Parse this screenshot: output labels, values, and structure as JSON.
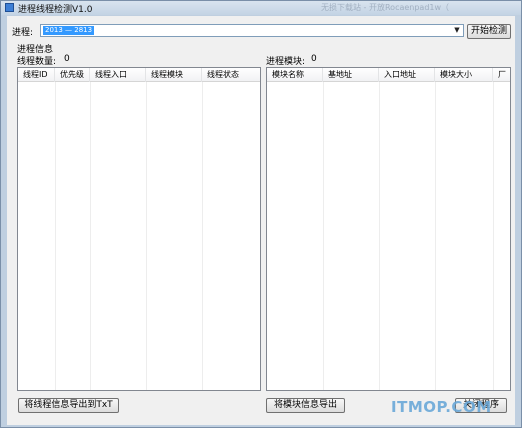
{
  "window": {
    "title": "进程线程检测V1.0",
    "background_title_text": "无损下载站 - 开放Rocaenpad1w（"
  },
  "process": {
    "label": "进程:",
    "selected_value": "2013 — 2813",
    "start_button": "开始检测"
  },
  "thread_section": {
    "group_label": "进程信息",
    "count_label": "线程数量:",
    "count_value": "0",
    "columns": [
      "线程ID",
      "优先级",
      "线程入口",
      "线程模块",
      "线程状态"
    ],
    "export_button": "将线程信息导出到TxT"
  },
  "module_section": {
    "count_label": "进程模块:",
    "count_value": "0",
    "columns": [
      "模块名称",
      "基地址",
      "入口地址",
      "模块大小",
      "厂"
    ],
    "export_button": "将模块信息导出",
    "close_button": "关闭程序"
  },
  "watermark": "ITMOP.COM",
  "colors": {
    "selection": "#3399ff",
    "window_frame": "#bfcfe0",
    "client": "#f0f0f0"
  }
}
